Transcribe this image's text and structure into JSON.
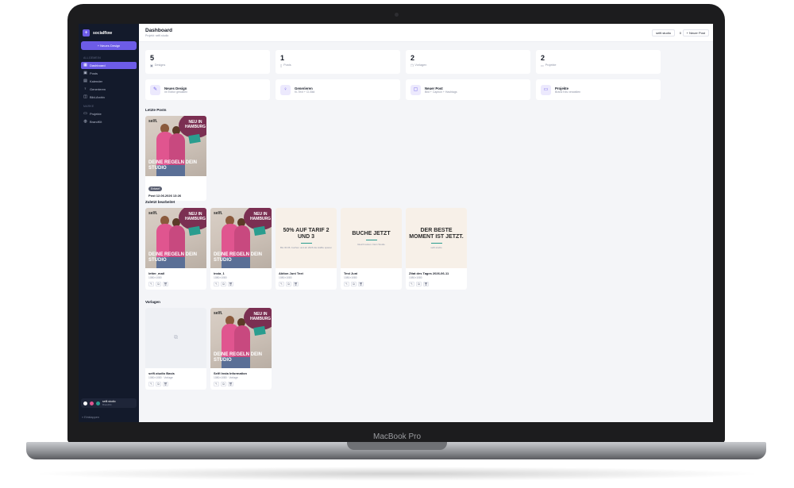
{
  "device": {
    "label": "MacBook Pro"
  },
  "app": {
    "brand": "socialflow",
    "new_design_button": "+ Neues Design",
    "nav_section_main": "Allgemein",
    "nav_section_more": "Marke",
    "nav": [
      {
        "label": "Dashboard",
        "icon": "grid-icon",
        "active": true
      },
      {
        "label": "Posts",
        "icon": "image-icon"
      },
      {
        "label": "Kalender",
        "icon": "calendar-icon"
      },
      {
        "label": "Generieren",
        "icon": "bulb-icon"
      },
      {
        "label": "Bild-Archiv",
        "icon": "archive-icon"
      }
    ],
    "nav_more": [
      {
        "label": "Projekte",
        "icon": "folder-icon"
      },
      {
        "label": "BrandKit",
        "icon": "palette-icon"
      }
    ],
    "workspace": {
      "name": "selfi.studio",
      "sub": "BrandKit"
    },
    "collapse_label": "« Einklappen"
  },
  "header": {
    "title": "Dashboard",
    "subtitle": "Projekt: selfi.studio",
    "workspace_select": "selfi.studio",
    "workspace_count": "0",
    "new_post_button": "+ Neuer Post"
  },
  "stats": [
    {
      "value": "5",
      "label": "Designs",
      "icon": "image-icon"
    },
    {
      "value": "1",
      "label": "Posts",
      "icon": "doc-icon"
    },
    {
      "value": "2",
      "label": "Vorlagen",
      "icon": "template-icon"
    },
    {
      "value": "2",
      "label": "Projekte",
      "icon": "folder-icon"
    }
  ],
  "actions": [
    {
      "title": "Neues Design",
      "sub": "Im Editor gestalten",
      "icon": "pen-icon"
    },
    {
      "title": "Generieren",
      "sub": "KI-Text + CI-Bild",
      "icon": "bulb-icon"
    },
    {
      "title": "Neuer Post",
      "sub": "Bild + Caption + Hashtags",
      "icon": "post-icon"
    },
    {
      "title": "Projekte",
      "sub": "Brand Kits verwalten",
      "icon": "folder-icon"
    }
  ],
  "sections": {
    "recent_posts": "Letzte Posts",
    "recently_edited": "Zuletzt bearbeitet",
    "templates": "Vorlagen"
  },
  "recent_posts": [
    {
      "badge": "Entwurf",
      "title": "Post 12.06.2026 13:26",
      "logo": "selfi.",
      "sticker": "NEU IN HAMBURG",
      "caption": "DEINE REGELN DEIN STUDIO"
    }
  ],
  "recently_edited": [
    {
      "kind": "photo",
      "title": "letter_mail",
      "sub": "1080×1080",
      "logo": "selfi.",
      "sticker": "NEU IN HAMBURG",
      "caption": "DEINE REGELN DEIN STUDIO"
    },
    {
      "kind": "photo",
      "title": "insta_1",
      "sub": "1080×1080",
      "logo": "selfi.",
      "sticker": "NEU IN HAMBURG",
      "caption": "DEINE REGELN DEIN STUDIO"
    },
    {
      "kind": "text",
      "title": "Aktion Juni Text",
      "sub": "1080×1080",
      "headline": "50% AUF TARIF 2 UND 3",
      "small": "Bis 30.06. buchen und ab 2026 die Hälfte sparen"
    },
    {
      "kind": "text",
      "title": "Test Juni",
      "sub": "1080×1080",
      "headline": "BUCHE JETZT",
      "small": "Gleich testen. Dein Studio"
    },
    {
      "kind": "text",
      "title": "Zitat des Tages 2026-06-11",
      "sub": "1080×1080",
      "headline": "DER BESTE MOMENT IST JETZT.",
      "small": "selfi.studio"
    }
  ],
  "templates": [
    {
      "kind": "blank",
      "title": "selfi.studio Basis",
      "sub": "1080×1080 · Vorlage"
    },
    {
      "kind": "photo",
      "title": "Selfi Insta Information",
      "sub": "1080×1080 · Vorlage",
      "logo": "selfi.",
      "sticker": "NEU IN HAMBURG",
      "caption": "DEINE REGELN DEIN STUDIO"
    }
  ],
  "colors": {
    "accent": "#6d5ce7",
    "sidebar": "#131a2b",
    "brand_plum": "#7b2f52",
    "brand_pink": "#e0558f",
    "brand_teal": "#2a9d8f"
  }
}
